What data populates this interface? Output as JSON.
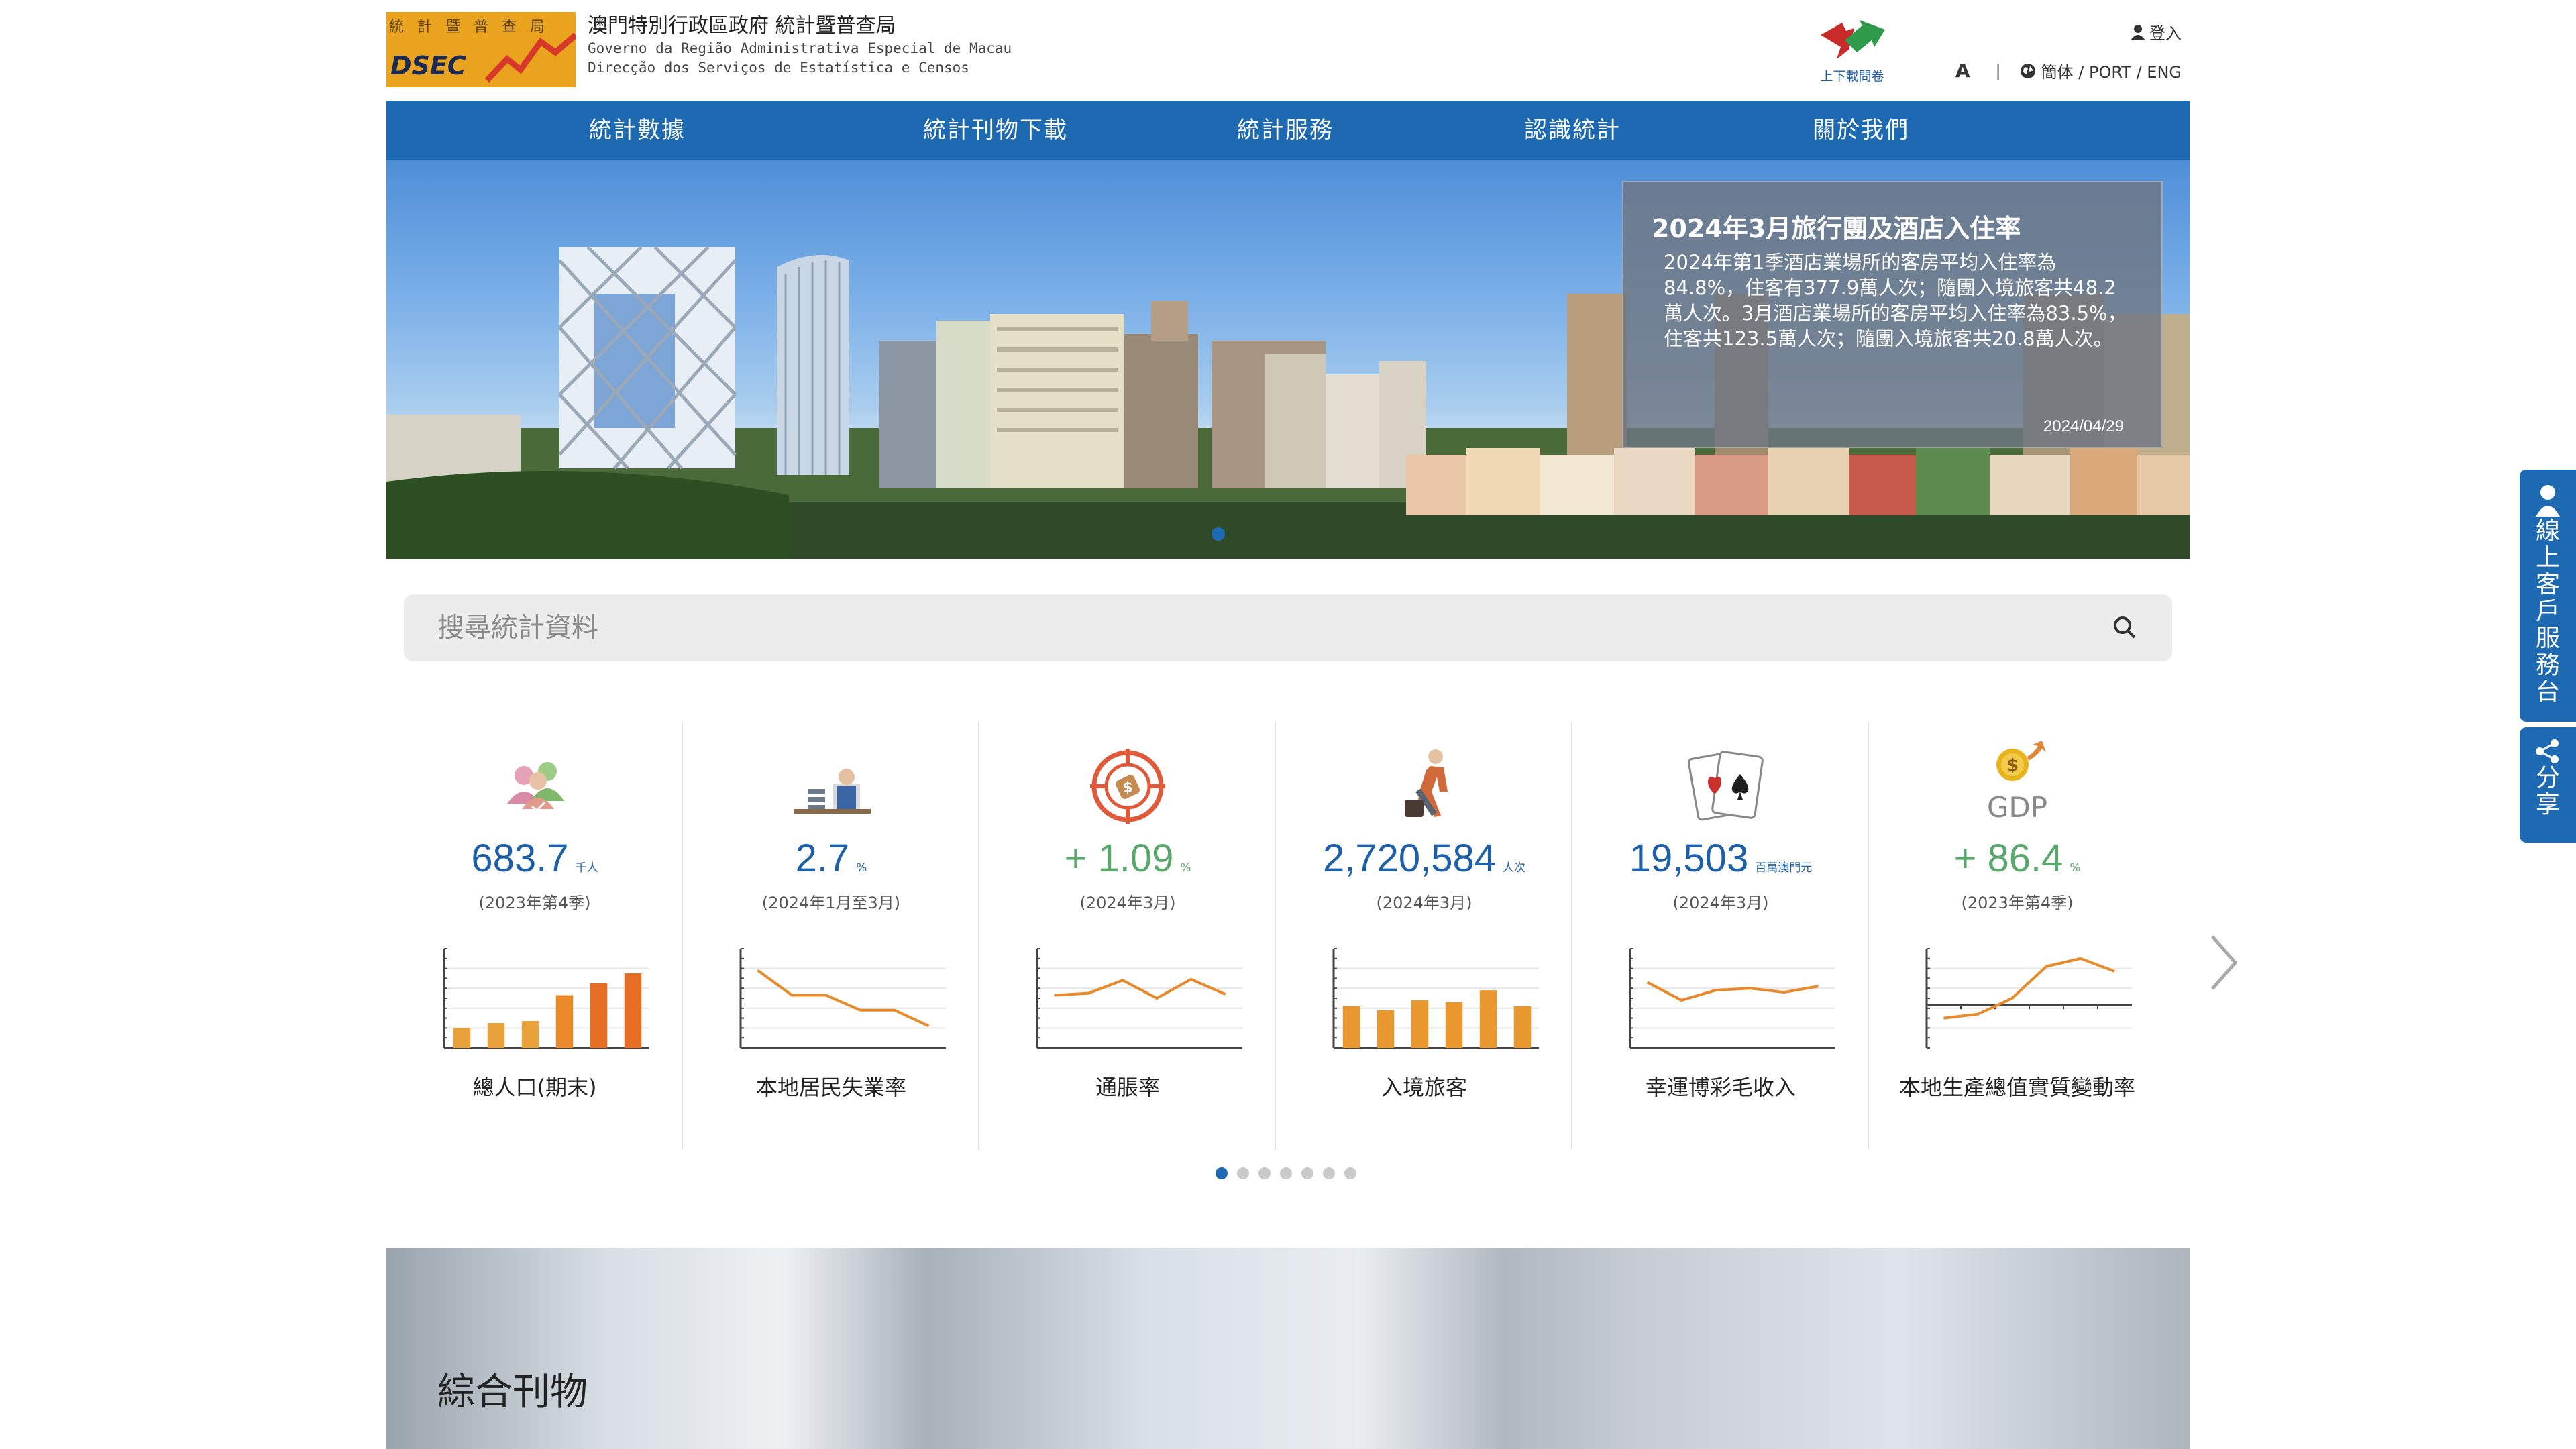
{
  "header": {
    "logo_chars": "統計暨普查局",
    "logo_text": "DSEC",
    "org_zh": "澳門特別行政區政府 統計暨普查局",
    "org_pt1": "Governo da Região Administrativa Especial de Macau",
    "org_pt2": "Direcção dos Serviços de Estatística e Censos",
    "survey_label": "上下載問卷",
    "login": "登入",
    "font_size_label": "A",
    "divider": "|",
    "languages": "簡体 / PORT / ENG"
  },
  "nav": {
    "items": [
      "統計數據",
      "統計刊物下載",
      "統計服務",
      "認識統計",
      "關於我們"
    ]
  },
  "banner": {
    "title": "2024年3月旅行團及酒店入住率",
    "body": "2024年第1季酒店業場所的客房平均入住率為84.8%，住客有377.9萬人次；隨團入境旅客共48.2萬人次。3月酒店業場所的客房平均入住率為83.5%，住客共123.5萬人次；隨團入境旅客共20.8萬人次。",
    "date": "2024/04/29"
  },
  "search": {
    "placeholder": "搜尋統計資料"
  },
  "stats": [
    {
      "value": "683.7",
      "unit": "千人",
      "period": "(2023年第4季)",
      "name": "總人口(期末)",
      "positive": false
    },
    {
      "value": "2.7",
      "unit": "%",
      "period": "(2024年1月至3月)",
      "name": "本地居民失業率",
      "positive": false
    },
    {
      "value": "+ 1.09",
      "unit": "%",
      "period": "(2024年3月)",
      "name": "通脹率",
      "positive": true
    },
    {
      "value": "2,720,584",
      "unit": "人次",
      "period": "(2024年3月)",
      "name": "入境旅客",
      "positive": false
    },
    {
      "value": "19,503",
      "unit": "百萬澳門元",
      "period": "(2024年3月)",
      "name": "幸運博彩毛收入",
      "positive": false
    },
    {
      "value": "+ 86.4",
      "unit": "%",
      "period": "(2023年第4季)",
      "name": "本地生產總值實質變動率",
      "positive": true
    }
  ],
  "chart_data": [
    {
      "type": "bar",
      "values": [
        2,
        2.5,
        2.7,
        5.3,
        6.5,
        7.5
      ],
      "ylim": [
        0,
        10
      ]
    },
    {
      "type": "line",
      "values": [
        7.8,
        5.3,
        5.3,
        3.8,
        3.8,
        2.2
      ],
      "ylim": [
        0,
        10
      ]
    },
    {
      "type": "line",
      "values": [
        5.3,
        5.5,
        6.8,
        5,
        6.9,
        5.4
      ],
      "ylim": [
        0,
        10
      ]
    },
    {
      "type": "bar",
      "values": [
        4.2,
        3.8,
        4.8,
        4.6,
        5.8,
        4.2
      ],
      "ylim": [
        0,
        10
      ]
    },
    {
      "type": "line",
      "values": [
        6.6,
        4.8,
        5.8,
        6,
        5.6,
        6.2
      ],
      "ylim": [
        0,
        10
      ]
    },
    {
      "type": "line",
      "values": [
        3,
        3.4,
        5,
        8.2,
        9,
        7.7
      ],
      "ylim": [
        0,
        10
      ],
      "baseline": 4.3
    }
  ],
  "pagination": {
    "pages": 7,
    "active": 0
  },
  "publications": {
    "title": "綜合刊物"
  },
  "side": {
    "help": "線上客戶服務台",
    "share": "分享"
  },
  "colors": {
    "primary": "#1d6ab2",
    "positive": "#5aa86b",
    "chart": "#e8892a"
  }
}
